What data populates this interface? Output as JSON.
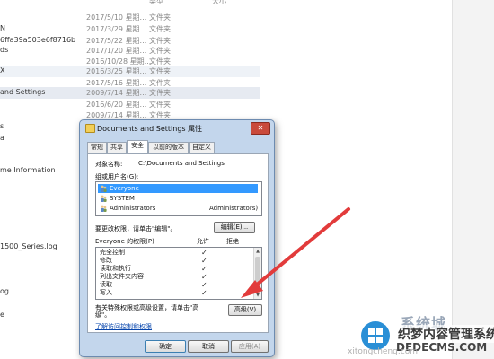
{
  "explorer": {
    "header_col_type": "类型",
    "header_col_size": "大小",
    "left_items": [
      "N",
      "6ffa39a503e6f8716b",
      "ds",
      "X",
      "and Settings",
      "s",
      "a",
      "me Information",
      "1500_Series.log",
      "og",
      "e"
    ],
    "rows": [
      {
        "date": "2017/5/10 星期...",
        "type": "文件夹"
      },
      {
        "date": "2017/3/29 星期...",
        "type": "文件夹"
      },
      {
        "date": "2017/5/22 星期...",
        "type": "文件夹"
      },
      {
        "date": "2017/1/20 星期...",
        "type": "文件夹"
      },
      {
        "date": "2016/10/28 星期...",
        "type": "文件夹"
      },
      {
        "date": "2016/3/25 星期...",
        "type": "文件夹"
      },
      {
        "date": "2017/5/16 星期...",
        "type": "文件夹"
      },
      {
        "date": "2009/7/14 星期...",
        "type": "文件夹"
      },
      {
        "date": "2016/6/20 星期...",
        "type": "文件夹"
      },
      {
        "date": "2009/7/14 星期...",
        "type": "文件夹"
      }
    ]
  },
  "dialog": {
    "title": "Documents and Settings 属性",
    "tabs": [
      "常规",
      "共享",
      "安全",
      "以前的版本",
      "自定义"
    ],
    "active_tab": "安全",
    "object_name_label": "对象名称:",
    "object_name_value": "C:\\Documents and Settings",
    "group_label": "组或用户名(G):",
    "users": [
      {
        "name": "Everyone",
        "extra": ""
      },
      {
        "name": "SYSTEM",
        "extra": ""
      },
      {
        "name": "Administrators",
        "extra": "Administrators)"
      }
    ],
    "change_perm_text": "要更改权限，请单击\"编辑\"。",
    "edit_button": "编辑(E)...",
    "perm_header_label": "Everyone 的权限(P)",
    "allow_label": "允许",
    "deny_label": "拒绝",
    "permissions": [
      {
        "name": "完全控制",
        "allow": "✓"
      },
      {
        "name": "修改",
        "allow": "✓"
      },
      {
        "name": "读取和执行",
        "allow": "✓"
      },
      {
        "name": "列出文件夹内容",
        "allow": "✓"
      },
      {
        "name": "读取",
        "allow": "✓"
      },
      {
        "name": "写入",
        "allow": "✓"
      }
    ],
    "special_text_1": "有关特殊权限或高级设置，请单击\"高",
    "special_text_2": "级\"。",
    "advanced_button": "高级(V)",
    "learn_link": "了解访问控制和权限",
    "ok_button": "确定",
    "cancel_button": "取消",
    "apply_button": "应用(A)"
  },
  "watermark": {
    "brand": "系统城",
    "site_cn": "织梦内容管理系统",
    "site_en": "DEDECMS.COM",
    "url_partial": "xitongcheng.com"
  },
  "colors": {
    "dialog_frame": "#c3d6ec",
    "selection": "#3399ff",
    "arrow": "#e23b3b"
  }
}
